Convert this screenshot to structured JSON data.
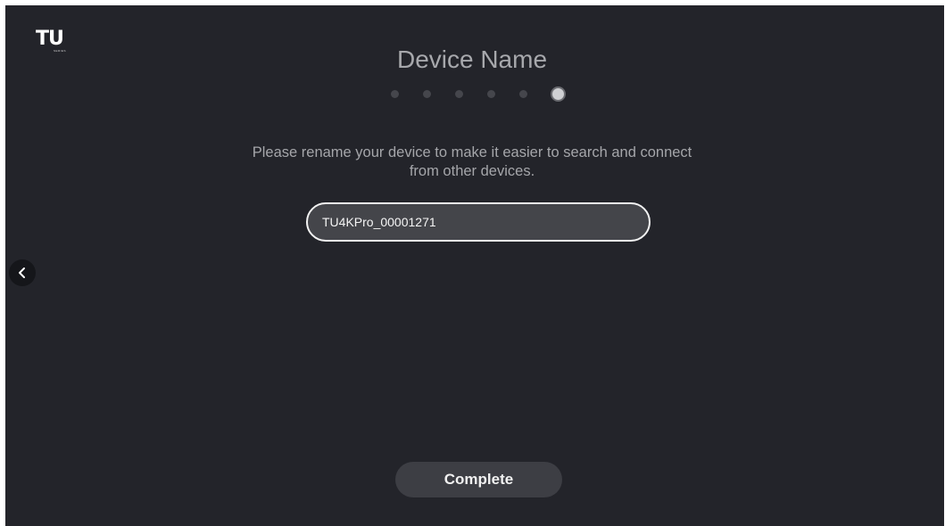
{
  "brand": {
    "logo_text": "TU",
    "logo_subtext": "SERIES"
  },
  "page": {
    "title": "Device Name",
    "description": "Please rename your device to make it easier to search and connect from other devices."
  },
  "progress": {
    "total_steps": 6,
    "current_step": 6
  },
  "device_name_field": {
    "value": "TU4KPro_00001271"
  },
  "actions": {
    "complete_label": "Complete",
    "back_icon": "chevron-left-icon"
  },
  "colors": {
    "background": "#23242a",
    "text_muted": "#a7a8ac",
    "field_border": "#f2f2f2",
    "button_bg": "#3d3e44"
  }
}
